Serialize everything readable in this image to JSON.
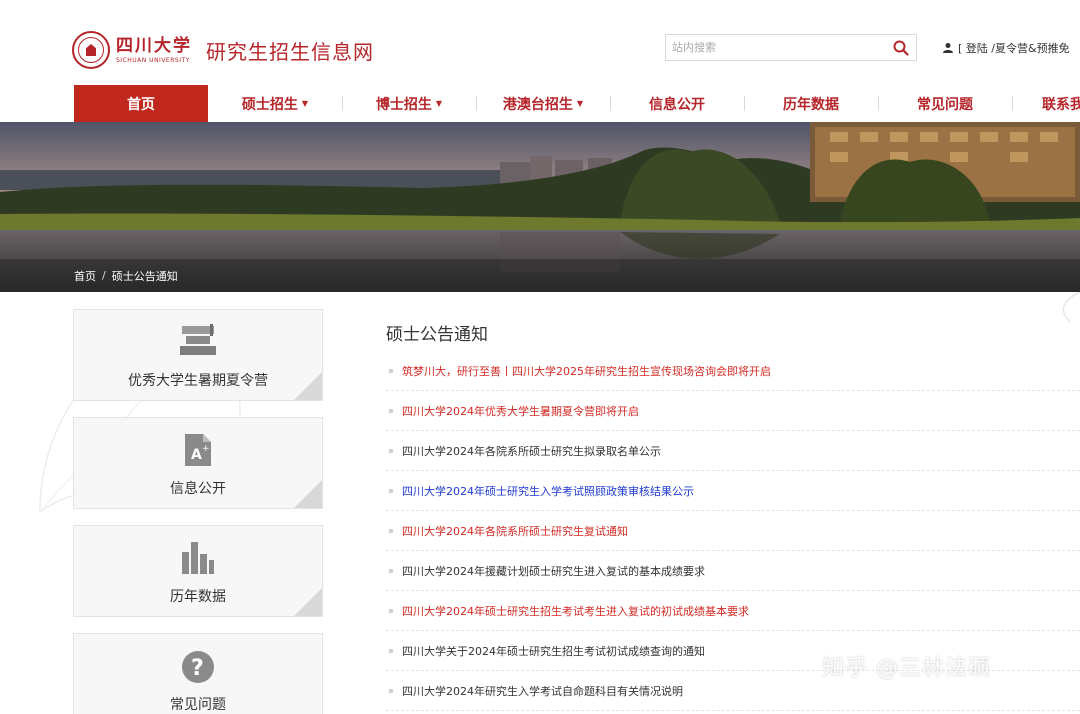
{
  "header": {
    "university_name_cn": "四川大学",
    "university_name_en": "SICHUAN UNIVERSITY",
    "site_title": "研究生招生信息网",
    "search": {
      "placeholder": "站内搜索"
    },
    "user_links": "[ 登陆 /夏令营&预推免"
  },
  "nav": {
    "items": [
      {
        "label": "首页",
        "active": true,
        "dropdown": false
      },
      {
        "label": "硕士招生",
        "active": false,
        "dropdown": true
      },
      {
        "label": "博士招生",
        "active": false,
        "dropdown": true
      },
      {
        "label": "港澳台招生",
        "active": false,
        "dropdown": true
      },
      {
        "label": "信息公开",
        "active": false,
        "dropdown": false
      },
      {
        "label": "历年数据",
        "active": false,
        "dropdown": false
      },
      {
        "label": "常见问题",
        "active": false,
        "dropdown": false
      },
      {
        "label": "联系我",
        "active": false,
        "dropdown": false
      }
    ]
  },
  "breadcrumb": {
    "home": "首页",
    "separator": "/",
    "current": "硕士公告通知"
  },
  "sidebar": {
    "cards": [
      {
        "label": "优秀大学生暑期夏令营",
        "icon": "books-icon"
      },
      {
        "label": "信息公开",
        "icon": "document-icon"
      },
      {
        "label": "历年数据",
        "icon": "bar-chart-icon"
      },
      {
        "label": "常见问题",
        "icon": "question-icon"
      }
    ]
  },
  "main": {
    "section_title": "硕士公告通知",
    "news": [
      {
        "text": "筑梦川大，研行至善丨四川大学2025年研究生招生宣传现场咨询会即将开启",
        "color": "red"
      },
      {
        "text": "四川大学2024年优秀大学生暑期夏令营即将开启",
        "color": "red"
      },
      {
        "text": "四川大学2024年各院系所硕士研究生拟录取名单公示",
        "color": "dark"
      },
      {
        "text": "四川大学2024年硕士研究生入学考试照顾政策审核结果公示",
        "color": "blue"
      },
      {
        "text": "四川大学2024年各院系所硕士研究生复试通知",
        "color": "red"
      },
      {
        "text": "四川大学2024年援藏计划硕士研究生进入复试的基本成绩要求",
        "color": "dark"
      },
      {
        "text": "四川大学2024年硕士研究生招生考试考生进入复试的初试成绩基本要求",
        "color": "red"
      },
      {
        "text": "四川大学关于2024年硕士研究生招生考试初试成绩查询的通知",
        "color": "dark"
      },
      {
        "text": "四川大学2024年研究生入学考试自命题科目有关情况说明",
        "color": "dark"
      }
    ]
  },
  "watermark": "知乎 @三林法硕",
  "colors": {
    "brand_red": "#c0271d",
    "link_red": "#d42a24",
    "link_blue": "#1f3ad0"
  }
}
